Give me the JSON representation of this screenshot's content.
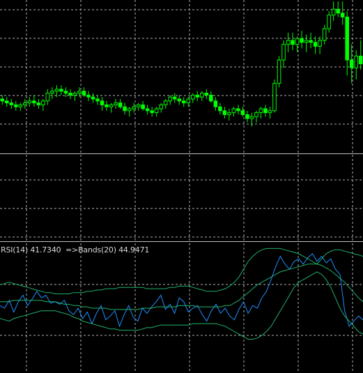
{
  "colors": {
    "background": "#000000",
    "grid": "#b0b0b0",
    "candle_up": "#00ff00",
    "candle_down": "#00ff00",
    "rsi_line": "#1e90ff",
    "bands_line": "#20b26b",
    "separator": "#c0c0c0",
    "label_text": "#d9d9d9"
  },
  "indicator_label": {
    "rsi": "RSI(14) 41.7340",
    "bands": "=>Bands(20) 44.9471"
  },
  "chart_data": [
    {
      "type": "candlestick",
      "title": "",
      "ylim": [
        0,
        100
      ],
      "candles": [
        [
          50,
          52,
          47,
          49
        ],
        [
          49,
          51,
          46,
          48
        ],
        [
          48,
          50,
          45,
          47
        ],
        [
          47,
          49,
          44,
          46
        ],
        [
          46,
          48,
          44,
          47
        ],
        [
          47,
          50,
          45,
          48
        ],
        [
          48,
          51,
          46,
          49
        ],
        [
          49,
          52,
          46,
          48
        ],
        [
          48,
          50,
          45,
          47
        ],
        [
          47,
          50,
          44,
          49
        ],
        [
          49,
          55,
          47,
          53
        ],
        [
          53,
          56,
          50,
          54
        ],
        [
          54,
          57,
          51,
          55
        ],
        [
          55,
          57,
          52,
          54
        ],
        [
          54,
          56,
          51,
          53
        ],
        [
          53,
          55,
          50,
          52
        ],
        [
          52,
          54,
          49,
          53
        ],
        [
          53,
          56,
          51,
          54
        ],
        [
          54,
          56,
          51,
          52
        ],
        [
          52,
          54,
          49,
          51
        ],
        [
          51,
          53,
          48,
          50
        ],
        [
          50,
          52,
          47,
          49
        ],
        [
          49,
          51,
          44,
          47
        ],
        [
          47,
          49,
          44,
          46
        ],
        [
          46,
          48,
          43,
          47
        ],
        [
          47,
          50,
          45,
          48
        ],
        [
          48,
          50,
          45,
          46
        ],
        [
          46,
          48,
          42,
          44
        ],
        [
          44,
          46,
          41,
          45
        ],
        [
          45,
          48,
          43,
          46
        ],
        [
          46,
          48,
          44,
          47
        ],
        [
          47,
          49,
          44,
          45
        ],
        [
          45,
          47,
          42,
          44
        ],
        [
          44,
          46,
          41,
          43
        ],
        [
          43,
          46,
          41,
          45
        ],
        [
          45,
          48,
          43,
          47
        ],
        [
          47,
          50,
          45,
          49
        ],
        [
          49,
          52,
          47,
          51
        ],
        [
          51,
          53,
          48,
          50
        ],
        [
          50,
          52,
          47,
          49
        ],
        [
          49,
          51,
          46,
          48
        ],
        [
          48,
          51,
          46,
          50
        ],
        [
          50,
          53,
          48,
          52
        ],
        [
          52,
          54,
          49,
          51
        ],
        [
          51,
          54,
          49,
          53
        ],
        [
          53,
          55,
          50,
          52
        ],
        [
          52,
          54,
          48,
          49
        ],
        [
          49,
          51,
          44,
          46
        ],
        [
          46,
          48,
          42,
          44
        ],
        [
          44,
          46,
          40,
          42
        ],
        [
          42,
          45,
          39,
          43
        ],
        [
          43,
          46,
          41,
          45
        ],
        [
          45,
          47,
          42,
          44
        ],
        [
          44,
          46,
          41,
          42
        ],
        [
          42,
          44,
          38,
          40
        ],
        [
          40,
          43,
          36,
          41
        ],
        [
          41,
          44,
          38,
          43
        ],
        [
          43,
          46,
          40,
          45
        ],
        [
          45,
          47,
          41,
          43
        ],
        [
          43,
          46,
          40,
          44
        ],
        [
          44,
          60,
          43,
          58
        ],
        [
          58,
          72,
          56,
          70
        ],
        [
          70,
          80,
          66,
          78
        ],
        [
          78,
          84,
          74,
          80
        ],
        [
          80,
          84,
          75,
          78
        ],
        [
          78,
          82,
          74,
          81
        ],
        [
          81,
          85,
          76,
          79
        ],
        [
          79,
          83,
          74,
          80
        ],
        [
          80,
          84,
          76,
          79
        ],
        [
          79,
          82,
          73,
          77
        ],
        [
          77,
          82,
          73,
          80
        ],
        [
          80,
          88,
          78,
          86
        ],
        [
          86,
          95,
          84,
          93
        ],
        [
          93,
          100,
          90,
          96
        ],
        [
          96,
          100,
          92,
          94
        ],
        [
          94,
          100,
          88,
          92
        ],
        [
          92,
          95,
          62,
          70
        ],
        [
          70,
          78,
          58,
          66
        ],
        [
          66,
          75,
          60,
          72
        ],
        [
          72,
          80,
          65,
          68
        ]
      ]
    },
    {
      "type": "line",
      "title": "RSI(14) 41.7340 =>Bands(20) 44.9471",
      "ylim": [
        0,
        100
      ],
      "series": [
        {
          "name": "RSI(14)",
          "values": [
            52,
            50,
            56,
            47,
            55,
            60,
            52,
            57,
            63,
            58,
            60,
            54,
            55,
            53,
            56,
            48,
            45,
            50,
            42,
            47,
            38,
            46,
            52,
            41,
            44,
            48,
            36,
            45,
            52,
            43,
            40,
            50,
            46,
            51,
            55,
            60,
            49,
            53,
            46,
            58,
            55,
            47,
            50,
            52,
            45,
            40,
            48,
            53,
            46,
            50,
            44,
            41,
            49,
            55,
            46,
            52,
            50,
            58,
            63,
            72,
            82,
            90,
            84,
            80,
            86,
            88,
            84,
            89,
            92,
            86,
            90,
            85,
            88,
            80,
            76,
            48,
            36,
            40,
            44,
            41
          ]
        },
        {
          "name": "Bands(20) upper",
          "values": [
            68,
            69,
            70,
            69,
            68,
            67,
            66,
            65,
            64,
            63,
            62,
            62,
            61,
            61,
            61,
            61,
            62,
            62,
            62,
            63,
            63,
            64,
            64,
            65,
            65,
            65,
            66,
            66,
            66,
            66,
            66,
            66,
            65,
            65,
            65,
            65,
            65,
            66,
            66,
            67,
            67,
            67,
            66,
            65,
            64,
            63,
            63,
            63,
            64,
            65,
            67,
            70,
            74,
            80,
            86,
            90,
            93,
            95,
            96,
            96,
            96,
            96,
            95,
            94,
            93,
            92,
            90,
            88,
            86,
            84,
            88,
            92,
            94,
            95,
            95,
            94,
            93,
            92,
            91,
            90
          ]
        },
        {
          "name": "Bands(20) middle",
          "values": [
            55,
            55,
            55,
            56,
            56,
            56,
            56,
            56,
            56,
            56,
            55,
            55,
            55,
            54,
            53,
            53,
            52,
            52,
            51,
            51,
            50,
            50,
            50,
            50,
            49,
            49,
            49,
            49,
            49,
            49,
            49,
            50,
            50,
            50,
            51,
            51,
            51,
            51,
            51,
            52,
            52,
            52,
            52,
            51,
            51,
            51,
            51,
            51,
            51,
            52,
            52,
            54,
            56,
            59,
            62,
            65,
            68,
            70,
            72,
            74,
            76,
            78,
            79,
            80,
            81,
            82,
            83,
            84,
            84,
            84,
            83,
            81,
            79,
            76,
            73,
            70,
            66,
            62,
            58,
            55
          ]
        },
        {
          "name": "Bands(20) lower",
          "values": [
            42,
            41,
            40,
            42,
            43,
            44,
            45,
            46,
            47,
            48,
            48,
            48,
            48,
            47,
            46,
            45,
            43,
            42,
            40,
            39,
            38,
            37,
            36,
            35,
            34,
            34,
            33,
            33,
            33,
            33,
            33,
            34,
            35,
            35,
            36,
            37,
            37,
            37,
            37,
            37,
            37,
            37,
            38,
            38,
            38,
            38,
            38,
            38,
            37,
            36,
            34,
            32,
            30,
            28,
            26,
            26,
            27,
            29,
            32,
            36,
            42,
            48,
            54,
            60,
            66,
            70,
            72,
            74,
            76,
            78,
            76,
            72,
            66,
            58,
            50,
            44,
            40,
            36,
            32,
            30
          ]
        }
      ]
    }
  ]
}
